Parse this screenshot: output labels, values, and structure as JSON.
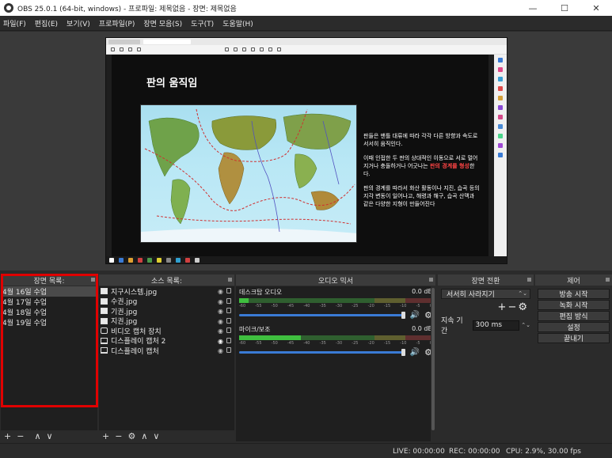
{
  "window": {
    "title": "OBS 25.0.1 (64-bit, windows) - 프로파일: 제목없음 - 장면: 제목없음",
    "minimize": "—",
    "maximize": "☐",
    "close": "✕"
  },
  "menu": [
    "파일(F)",
    "편집(E)",
    "보기(V)",
    "프로파일(P)",
    "장면 모음(S)",
    "도구(T)",
    "도움말(H)"
  ],
  "preview": {
    "slide_title": "판의 움직임",
    "paragraph1": "판들은 맨틀 대류에 따라 각각 다른 방향과 속도로 서서히 움직인다.",
    "paragraph2_a": "이때 인접한 두 판의 상대적인 이동으로 서로 멀어지거나 충돌하거나 어긋나는 ",
    "paragraph2_highlight": "판의 경계를 형성",
    "paragraph2_b": "한다.",
    "paragraph3": "판의 경계를 따라서 화산 활동이나 지진, 습곡 등의 지각 변동이 일어나고, 해령과 해구, 습곡 산맥과 같은 다양한 지형이 만들어진다"
  },
  "scenes": {
    "header": "장면 목록:",
    "items": [
      "4월 16일 수업",
      "4월 17일 수업",
      "4월 18일 수업",
      "4월 19일 수업"
    ],
    "footer": [
      "+",
      "−",
      "∧",
      "∨"
    ]
  },
  "sources": {
    "header": "소스 목록:",
    "items": [
      {
        "label": "지구시스템.jpg",
        "icon": "image-icon"
      },
      {
        "label": "수권.jpg",
        "icon": "image-icon"
      },
      {
        "label": "기권.jpg",
        "icon": "image-icon"
      },
      {
        "label": "지권.jpg",
        "icon": "image-icon"
      },
      {
        "label": "비디오 캡처 장치",
        "icon": "camera-icon"
      },
      {
        "label": "디스플레이 캡처 2",
        "icon": "monitor-icon"
      },
      {
        "label": "디스플레이 캡처",
        "icon": "monitor-icon"
      }
    ],
    "footer": [
      "+",
      "−",
      "⚙",
      "∧",
      "∨"
    ]
  },
  "mixer": {
    "header": "오디오 믹서",
    "tracks": [
      {
        "name": "데스크탑 오디오",
        "db": "0.0 dB",
        "level": 0.05
      },
      {
        "name": "마이크/보조",
        "db": "0.0 dB",
        "level": 0.32
      }
    ],
    "scale": [
      "-60",
      "-55",
      "-50",
      "-45",
      "-40",
      "-35",
      "-30",
      "-25",
      "-20",
      "-15",
      "-10",
      "-5",
      "0"
    ]
  },
  "transition": {
    "header": "장면 전환",
    "selected": "서서히 사라지기",
    "add": "+",
    "remove": "−",
    "settings": "⚙",
    "duration_label": "지속 기간",
    "duration_value": "300 ms"
  },
  "controls": {
    "header": "제어",
    "buttons": [
      "방송 시작",
      "녹화 시작",
      "편집 방식",
      "설정",
      "끝내기"
    ]
  },
  "status": {
    "live": "LIVE: 00:00:00",
    "rec": "REC: 00:00:00",
    "cpu": "CPU: 2.9%, 30.00 fps"
  }
}
